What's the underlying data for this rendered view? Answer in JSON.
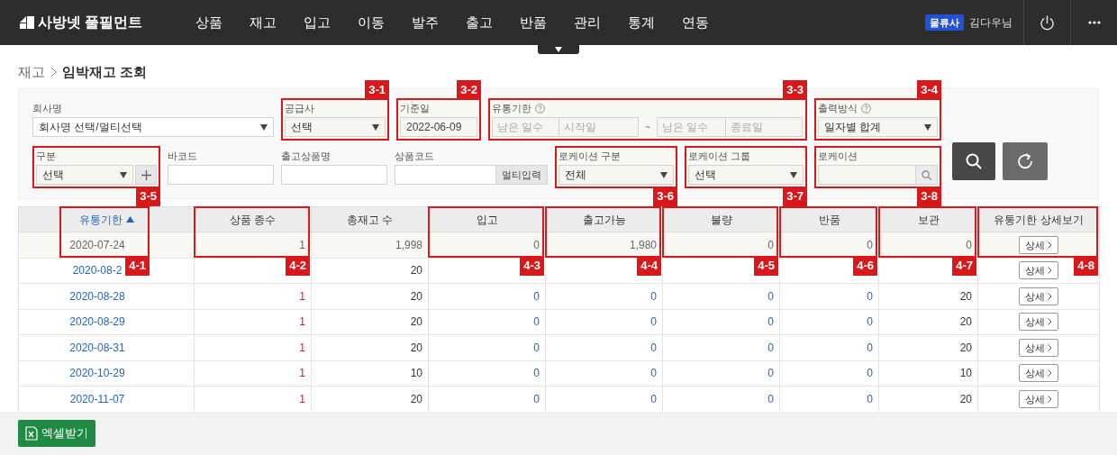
{
  "header": {
    "logo": "사방넷 풀필먼트",
    "menu": [
      {
        "label": "상품"
      },
      {
        "label": "재고"
      },
      {
        "label": "입고"
      },
      {
        "label": "이동"
      },
      {
        "label": "발주"
      },
      {
        "label": "출고"
      },
      {
        "label": "반품"
      },
      {
        "label": "관리"
      },
      {
        "label": "통계"
      },
      {
        "label": "연동"
      }
    ],
    "role_badge": "물류사",
    "user": "김다우님"
  },
  "breadcrumb": [
    "재고",
    "임박재고 조회"
  ],
  "filters": [
    [
      {
        "kind": "select",
        "label": "회사명",
        "value": "회사명 선택/멀티선택"
      },
      {
        "kind": "select",
        "label": "공급사",
        "value": "선택",
        "annotation": "3-1"
      },
      {
        "kind": "date",
        "label": "기준일",
        "value": "2022-06-09",
        "annotation": "3-2"
      },
      {
        "kind": "range",
        "label": "유통기한",
        "help": true,
        "placeholders": [
          "남은 일수",
          "시작일",
          "남은 일수",
          "종료일"
        ],
        "separator": "~",
        "annotation": "3-3"
      },
      {
        "kind": "select",
        "label": "출력방식",
        "help": true,
        "value": "일자별 합계",
        "annotation": "3-4"
      }
    ],
    [
      {
        "kind": "select_add",
        "label": "구분",
        "value": "선택",
        "annotation": "3-5"
      },
      {
        "kind": "input",
        "label": "바코드"
      },
      {
        "kind": "input",
        "label": "출고상품명"
      },
      {
        "kind": "input_button",
        "label": "상품코드",
        "button": "멀티입력"
      },
      {
        "kind": "select",
        "label": "로케이션 구분",
        "value": "전체",
        "annotation": "3-6"
      },
      {
        "kind": "select",
        "label": "로케이션 그룹",
        "value": "선택",
        "annotation": "3-7"
      },
      {
        "kind": "search_input",
        "label": "로케이션",
        "annotation": "3-8"
      }
    ]
  ],
  "table": {
    "columns": [
      {
        "label": "유통기한",
        "kind": "date",
        "sorted": true,
        "annotation": "4-1"
      },
      {
        "label": "상품 종수",
        "kind": "kinds",
        "sorted": false,
        "annotation": "4-2"
      },
      {
        "label": "총재고 수",
        "kind": "total",
        "sorted": false
      },
      {
        "label": "입고",
        "kind": "flow",
        "sorted": false,
        "annotation": "4-3"
      },
      {
        "label": "출고가능",
        "kind": "flow",
        "sorted": false,
        "annotation": "4-4"
      },
      {
        "label": "불량",
        "kind": "flow",
        "sorted": false,
        "annotation": "4-5"
      },
      {
        "label": "반품",
        "kind": "flow",
        "sorted": false,
        "annotation": "4-6"
      },
      {
        "label": "보관",
        "kind": "total",
        "sorted": false,
        "annotation": "4-7"
      },
      {
        "label": "유통기한 상세보기",
        "kind": "action",
        "sorted": false,
        "annotation": "4-8"
      }
    ],
    "rows": [
      {
        "highlighted": true,
        "cells": [
          "2020-07-24",
          "1",
          "1,998",
          "0",
          "1,980",
          "0",
          "0",
          "0"
        ],
        "action": "상세"
      },
      {
        "highlighted": false,
        "cells": [
          "2020-08-2",
          null,
          "20",
          null,
          null,
          null,
          null,
          null
        ],
        "action": "상세"
      },
      {
        "highlighted": false,
        "cells": [
          "2020-08-28",
          "1",
          "20",
          "0",
          "0",
          "0",
          "0",
          "20"
        ],
        "action": "상세"
      },
      {
        "highlighted": false,
        "cells": [
          "2020-08-29",
          "1",
          "20",
          "0",
          "0",
          "0",
          "0",
          "20"
        ],
        "action": "상세"
      },
      {
        "highlighted": false,
        "cells": [
          "2020-08-31",
          "1",
          "20",
          "0",
          "0",
          "0",
          "0",
          "20"
        ],
        "action": "상세"
      },
      {
        "highlighted": false,
        "cells": [
          "2020-10-29",
          "1",
          "10",
          "0",
          "0",
          "0",
          "0",
          "10"
        ],
        "action": "상세"
      },
      {
        "highlighted": false,
        "cells": [
          "2020-11-07",
          "1",
          "20",
          "0",
          "0",
          "0",
          "0",
          "20"
        ],
        "action": "상세"
      }
    ]
  },
  "footer": {
    "excel_button": "엑셀받기"
  }
}
